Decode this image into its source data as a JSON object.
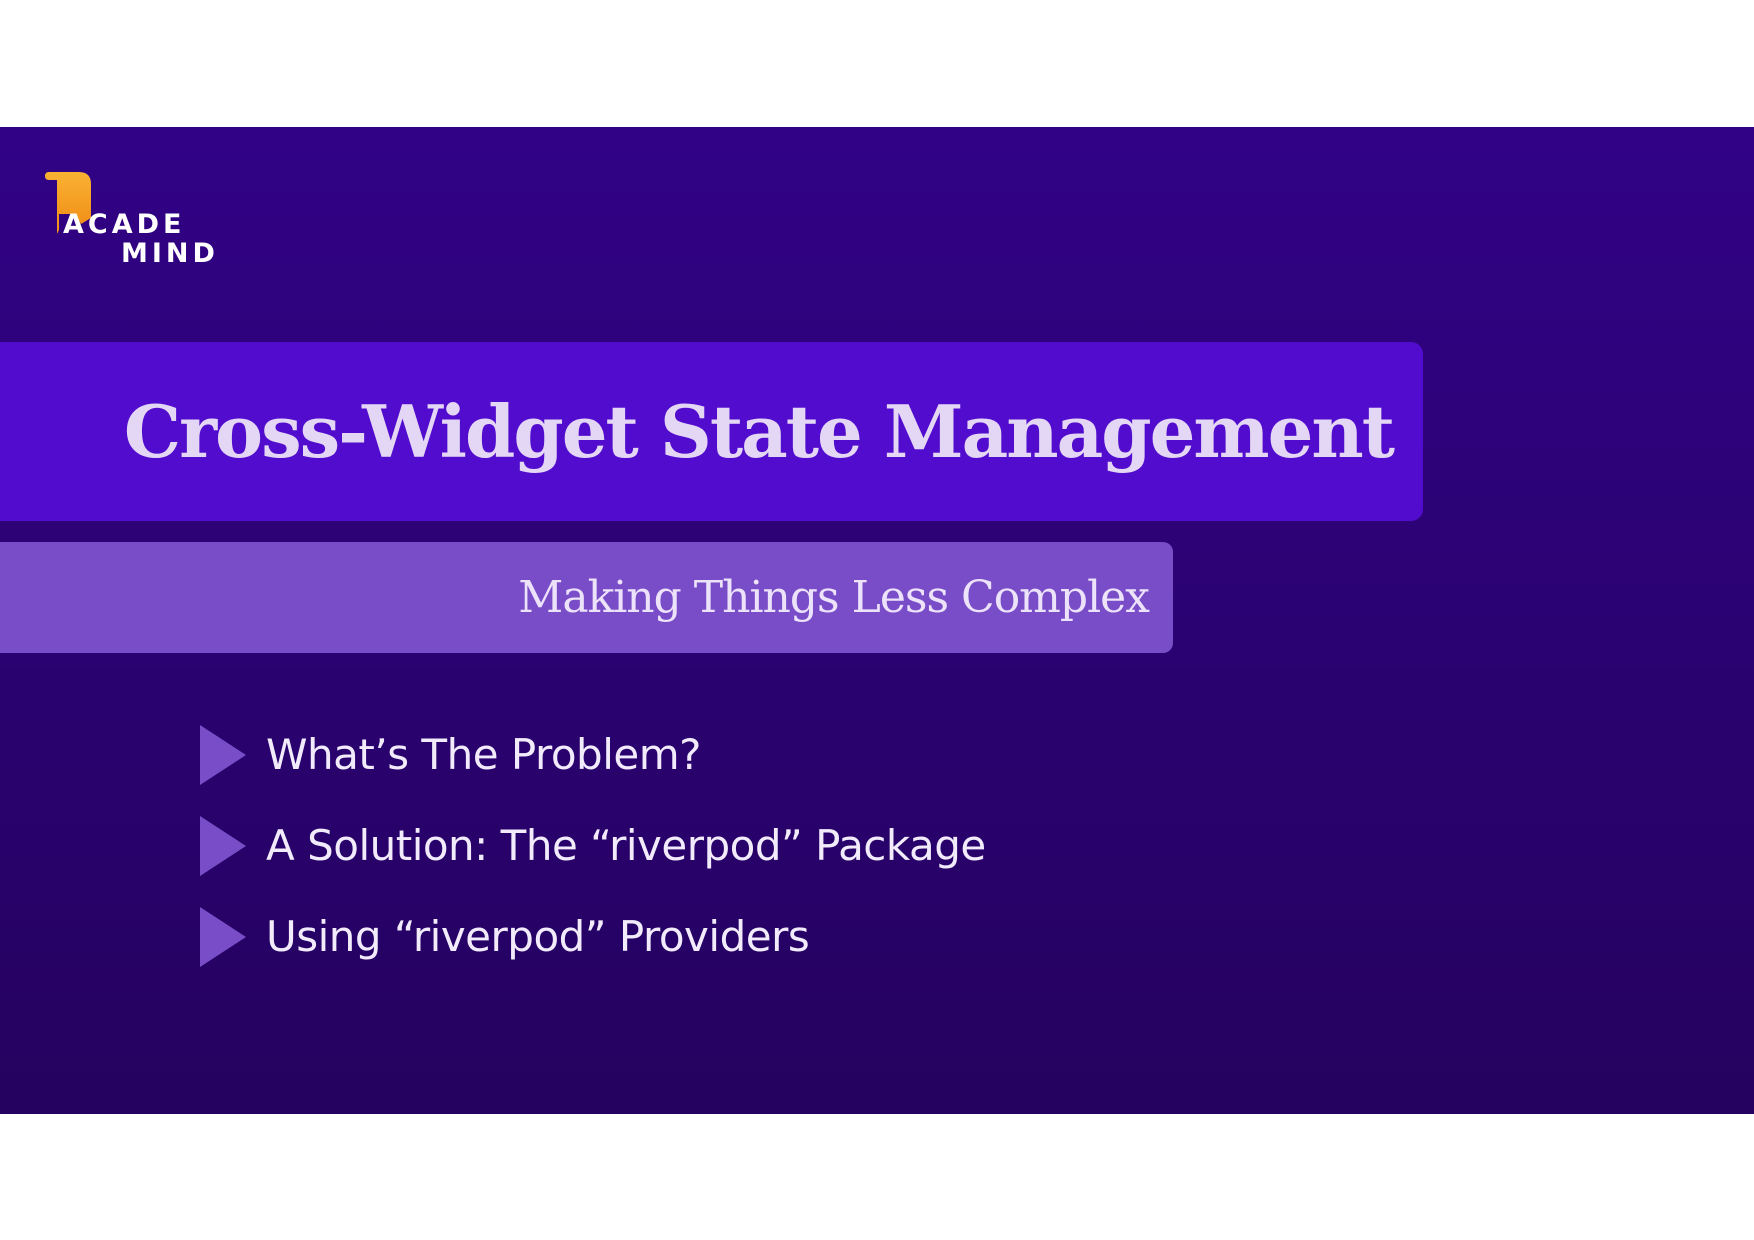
{
  "logo": {
    "line1": "ACADE",
    "line2": "MIND",
    "icon": "bookmark-icon",
    "accent_color": "#f5a623"
  },
  "title": "Cross-Widget State Management",
  "subtitle": "Making Things Less Complex",
  "bullets": [
    {
      "icon": "triangle-right-icon",
      "text": "What’s The Problem?"
    },
    {
      "icon": "triangle-right-icon",
      "text": "A Solution: The “riverpod” Package"
    },
    {
      "icon": "triangle-right-icon",
      "text": "Using “riverpod” Providers"
    }
  ],
  "colors": {
    "background_top": "#310286",
    "background_bottom": "#25025f",
    "title_bar": "#520ccd",
    "subtitle_bar": "#7a4dc8",
    "bullet_icon": "#7a4dc8",
    "title_text": "#e4d6f5"
  }
}
